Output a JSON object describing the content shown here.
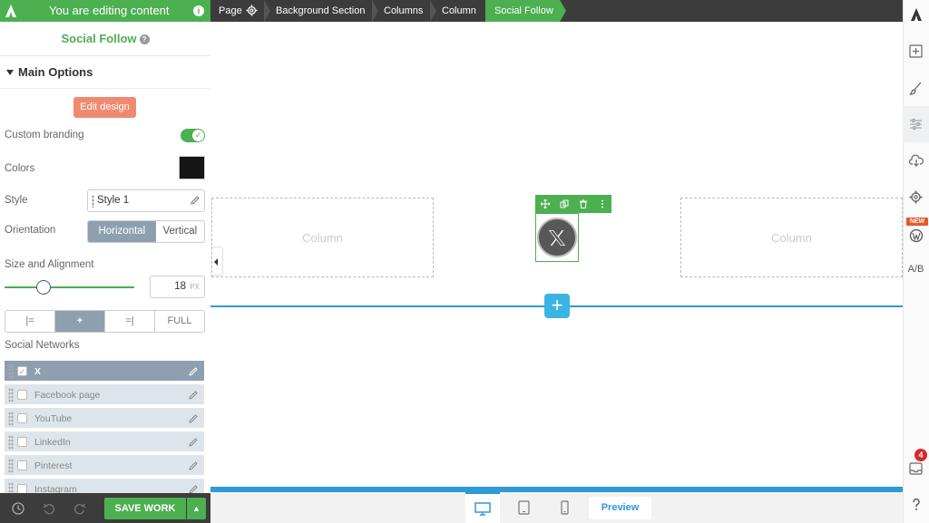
{
  "topbar": {
    "editing_banner": "You are editing content",
    "breadcrumbs": [
      "Page",
      "Background Section",
      "Columns",
      "Column",
      "Social Follow"
    ]
  },
  "panel": {
    "title": "Social Follow",
    "section": "Main Options",
    "edit_design": "Edit design",
    "custom_branding_label": "Custom branding",
    "custom_branding_on": true,
    "colors_label": "Colors",
    "color_value": "#151515",
    "style_label": "Style",
    "style_value": "Style 1",
    "orientation_label": "Orientation",
    "orientation_options": [
      "Horizontal",
      "Vertical"
    ],
    "orientation_selected": "Horizontal",
    "size_label": "Size and Alignment",
    "size_value": "18",
    "size_unit": "PX",
    "size_slider_fraction": 0.3,
    "align_options": [
      "|=",
      "+",
      "=|",
      "FULL"
    ],
    "align_selected": "+",
    "networks_label": "Social Networks",
    "networks": [
      {
        "name": "X",
        "checked": true
      },
      {
        "name": "Facebook page",
        "checked": false
      },
      {
        "name": "YouTube",
        "checked": false
      },
      {
        "name": "LinkedIn",
        "checked": false
      },
      {
        "name": "Pinterest",
        "checked": false
      },
      {
        "name": "Instagram",
        "checked": false
      }
    ]
  },
  "bottom": {
    "save_label": "SAVE WORK",
    "preview_label": "Preview"
  },
  "canvas": {
    "column_placeholder": "Column",
    "add_symbol": "+"
  },
  "rsidebar": {
    "new_badge": "NEW",
    "ab_label": "A/B",
    "notification_count": "4"
  },
  "colors": {
    "accent_green": "#4CAF50",
    "edit_design_orange": "#ef8a6f",
    "selection_blue": "#2e9ad6",
    "add_button": "#3bb4e5"
  }
}
